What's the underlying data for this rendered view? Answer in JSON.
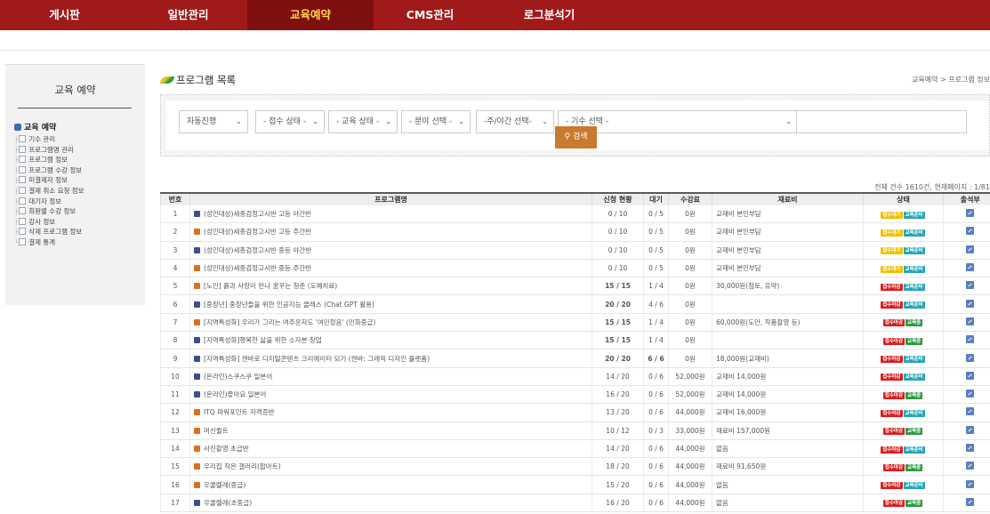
{
  "nav": [
    "게시판",
    "일반관리",
    "교육예약",
    "CMS관리",
    "로그분석기"
  ],
  "sidebar": {
    "title": "교육 예약",
    "root": "교육 예약",
    "items": [
      "기수 관리",
      "프로그램명 관리",
      "프로그램 정보",
      "프로그램 수강 정보",
      "미결제자 정보",
      "결제 취소 요청 정보",
      "대기자 정보",
      "회원별 수강 정보",
      "강사 정보",
      "삭제 프로그램 정보",
      "결제 통계"
    ]
  },
  "heading": "프로그램 목록",
  "breadcrumb": "교육예약 > 프로그램 정보",
  "filters": {
    "auto": "자동진행",
    "recv": "- 접수 상태 -",
    "edu": "- 교육 상태 -",
    "field": "- 분야 선택 -",
    "daynight": "-주/야간 선택-",
    "period": "- 기수 선택 -"
  },
  "search_label": "검색",
  "count_text": "전체 건수 1610건, 현재페이지 : 1/81",
  "columns": [
    "번호",
    "프로그램명",
    "신청 현황",
    "대기",
    "수강료",
    "재료비",
    "상태",
    "출석부"
  ],
  "badges": {
    "wait": "접수대기",
    "edu_wait": "교육준비",
    "recv_closed": "접수마감",
    "edu_now": "교육중"
  },
  "rows": [
    {
      "no": "1",
      "icon": "b",
      "name": "(성인대상)세종검정고시반 고등 야간반",
      "app": "0 / 10",
      "wait": "0 / 5",
      "fee": "0원",
      "mat": "교재비 본인부담",
      "s1": "wait",
      "s2": "edu_wait",
      "red": false,
      "wred": false
    },
    {
      "no": "2",
      "icon": "o",
      "name": "(성인대상)세종검정고시반 고등 주간반",
      "app": "0 / 10",
      "wait": "0 / 5",
      "fee": "0원",
      "mat": "교재비 본인부담",
      "s1": "wait",
      "s2": "edu_wait",
      "red": false,
      "wred": false
    },
    {
      "no": "3",
      "icon": "b",
      "name": "(성인대상)세종검정고시반 중등 야간반",
      "app": "0 / 10",
      "wait": "0 / 5",
      "fee": "0원",
      "mat": "교재비 본인부담",
      "s1": "wait",
      "s2": "edu_wait",
      "red": false,
      "wred": false
    },
    {
      "no": "4",
      "icon": "o",
      "name": "(성인대상)세종검정고시반 중등 주간반",
      "app": "0 / 10",
      "wait": "0 / 5",
      "fee": "0원",
      "mat": "교재비 본인부담",
      "s1": "wait",
      "s2": "edu_wait",
      "red": false,
      "wred": false
    },
    {
      "no": "5",
      "icon": "o",
      "name": "[노인] 흙과 사랑이 만나 꿈꾸는 청춘 (도예치료)",
      "app": "15 / 15",
      "wait": "1 / 4",
      "fee": "0원",
      "mat": "30,000원(점토, 유약)",
      "s1": "recv_closed",
      "s2": "edu_wait",
      "red": true,
      "wred": false
    },
    {
      "no": "6",
      "icon": "b",
      "name": "[중장년] 중장년들을 위한 인공지능 클래스 (Chat GPT 활용)",
      "app": "20 / 20",
      "wait": "4 / 6",
      "fee": "0원",
      "mat": "",
      "s1": "recv_closed",
      "s2": "edu_wait",
      "red": true,
      "wred": false
    },
    {
      "no": "7",
      "icon": "o",
      "name": "[지역특성화] 우리가 그리는 여주운자도 '여민정음' (민화중급)",
      "app": "15 / 15",
      "wait": "1 / 4",
      "fee": "0원",
      "mat": "60,000원(도안, 작품촬영 등)",
      "s1": "recv_closed",
      "s2": "edu_now",
      "red": true,
      "wred": false
    },
    {
      "no": "8",
      "icon": "b",
      "name": "[지역특성화]행복한 삶을 위한 소자본 창업",
      "app": "15 / 15",
      "wait": "1 / 4",
      "fee": "0원",
      "mat": "",
      "s1": "recv_closed",
      "s2": "edu_now",
      "red": true,
      "wred": false
    },
    {
      "no": "9",
      "icon": "b",
      "name": "[지역특성화] 캔바로 디지털콘텐츠 크리에이터 되기 (캔바: 그래픽 디자인 플랫폼)",
      "app": "20 / 20",
      "wait": "6 / 6",
      "fee": "0원",
      "mat": "18,000원(교재비)",
      "s1": "recv_closed",
      "s2": "edu_wait",
      "red": true,
      "wred": true
    },
    {
      "no": "10",
      "icon": "b",
      "name": "(온라인)스쿠스쿠 일본어",
      "app": "14 / 20",
      "wait": "0 / 6",
      "fee": "52,000원",
      "mat": "교재비 14,000원",
      "s1": "recv_closed",
      "s2": "edu_wait",
      "red": false,
      "wred": false
    },
    {
      "no": "11",
      "icon": "b",
      "name": "(온라인)좋아요 일본어",
      "app": "16 / 20",
      "wait": "0 / 6",
      "fee": "52,000원",
      "mat": "교재비 14,000원",
      "s1": "recv_closed",
      "s2": "edu_now",
      "red": false,
      "wred": false
    },
    {
      "no": "12",
      "icon": "o",
      "name": "ITQ 파워포인트 자격증반",
      "app": "13 / 20",
      "wait": "0 / 6",
      "fee": "44,000원",
      "mat": "교재비 16,000원",
      "s1": "recv_closed",
      "s2": "edu_wait",
      "red": false,
      "wred": false
    },
    {
      "no": "13",
      "icon": "o",
      "name": "머신퀼트",
      "app": "10 / 12",
      "wait": "0 / 3",
      "fee": "33,000원",
      "mat": "재료비 157,000원",
      "s1": "recv_closed",
      "s2": "edu_now",
      "red": false,
      "wred": false
    },
    {
      "no": "14",
      "icon": "o",
      "name": "사진촬영 초급반",
      "app": "14 / 20",
      "wait": "0 / 6",
      "fee": "44,000원",
      "mat": "없음",
      "s1": "recv_closed",
      "s2": "edu_wait",
      "red": false,
      "wred": false
    },
    {
      "no": "15",
      "icon": "o",
      "name": "우리집 작은 갤러리(팝아트)",
      "app": "18 / 20",
      "wait": "0 / 6",
      "fee": "44,000원",
      "mat": "재료비 91,650원",
      "s1": "recv_closed",
      "s2": "edu_now",
      "red": false,
      "wred": false
    },
    {
      "no": "16",
      "icon": "o",
      "name": "우쿨렐레(중급)",
      "app": "15 / 20",
      "wait": "0 / 6",
      "fee": "44,000원",
      "mat": "없음",
      "s1": "recv_closed",
      "s2": "edu_wait",
      "red": false,
      "wred": false
    },
    {
      "no": "17",
      "icon": "b",
      "name": "우쿨렐레(초중급)",
      "app": "16 / 20",
      "wait": "0 / 6",
      "fee": "44,000원",
      "mat": "없음",
      "s1": "recv_closed",
      "s2": "edu_now",
      "red": false,
      "wred": false
    }
  ]
}
